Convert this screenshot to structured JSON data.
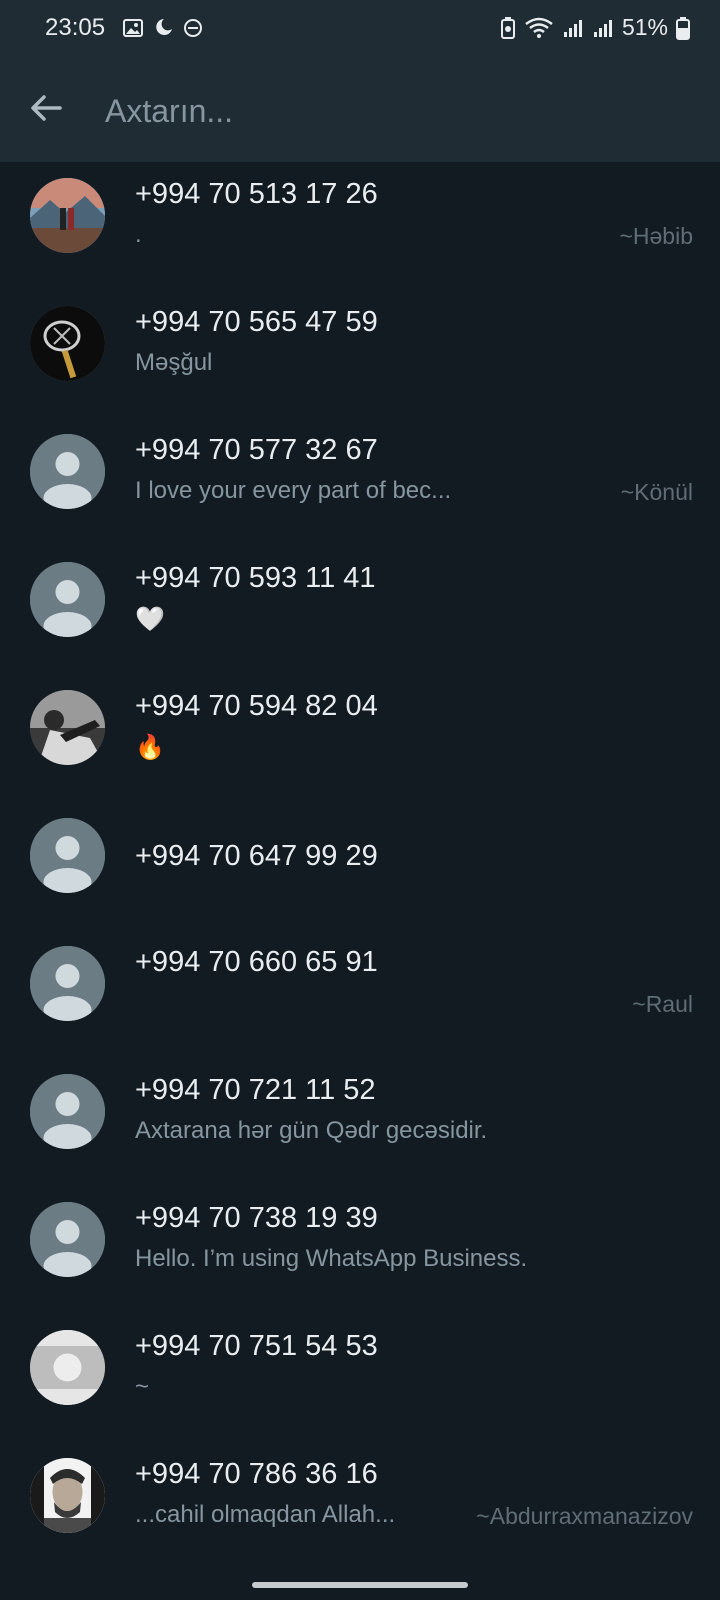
{
  "status_bar": {
    "time": "23:05",
    "left_icons": [
      "image-icon",
      "moon-leaf-icon",
      "do-not-disturb-icon"
    ],
    "right_icons": [
      "battery-saver-icon",
      "wifi-icon",
      "signal-icon",
      "signal-icon"
    ],
    "battery": "51%"
  },
  "search": {
    "placeholder": "Axtarın...",
    "value": ""
  },
  "contacts": [
    {
      "number": "+994 70 513 17 26",
      "about": ".",
      "push_name": "~Həbib"
    },
    {
      "number": "+994 70 565 47 59",
      "about": "Məşğul",
      "push_name": ""
    },
    {
      "number": "+994 70 577 32 67",
      "about": "I love your every part of bec...",
      "push_name": "~Könül"
    },
    {
      "number": "+994 70 593 11 41",
      "about": "🤍",
      "push_name": ""
    },
    {
      "number": "+994 70 594 82 04",
      "about": "🔥",
      "push_name": ""
    },
    {
      "number": "+994 70 647 99 29",
      "about": "",
      "push_name": ""
    },
    {
      "number": "+994 70 660 65 91",
      "about": "",
      "push_name": "~Raul"
    },
    {
      "number": "+994 70 721 11 52",
      "about": "Axtarana hər gün Qədr gecəsidir.",
      "push_name": ""
    },
    {
      "number": "+994 70 738 19 39",
      "about": "Hello. I’m using WhatsApp Business.",
      "push_name": ""
    },
    {
      "number": "+994 70 751 54 53",
      "about": "~",
      "push_name": ""
    },
    {
      "number": "+994 70 786 36 16",
      "about": "...cahil olmaqdan Allah...",
      "push_name": "~Abdurraxmanazizov"
    }
  ],
  "colors": {
    "background": "#121b22",
    "appbar": "#1f2c34",
    "primary_text": "#e9edef",
    "secondary_text": "#8696a0",
    "default_avatar": "#6b7c85"
  }
}
